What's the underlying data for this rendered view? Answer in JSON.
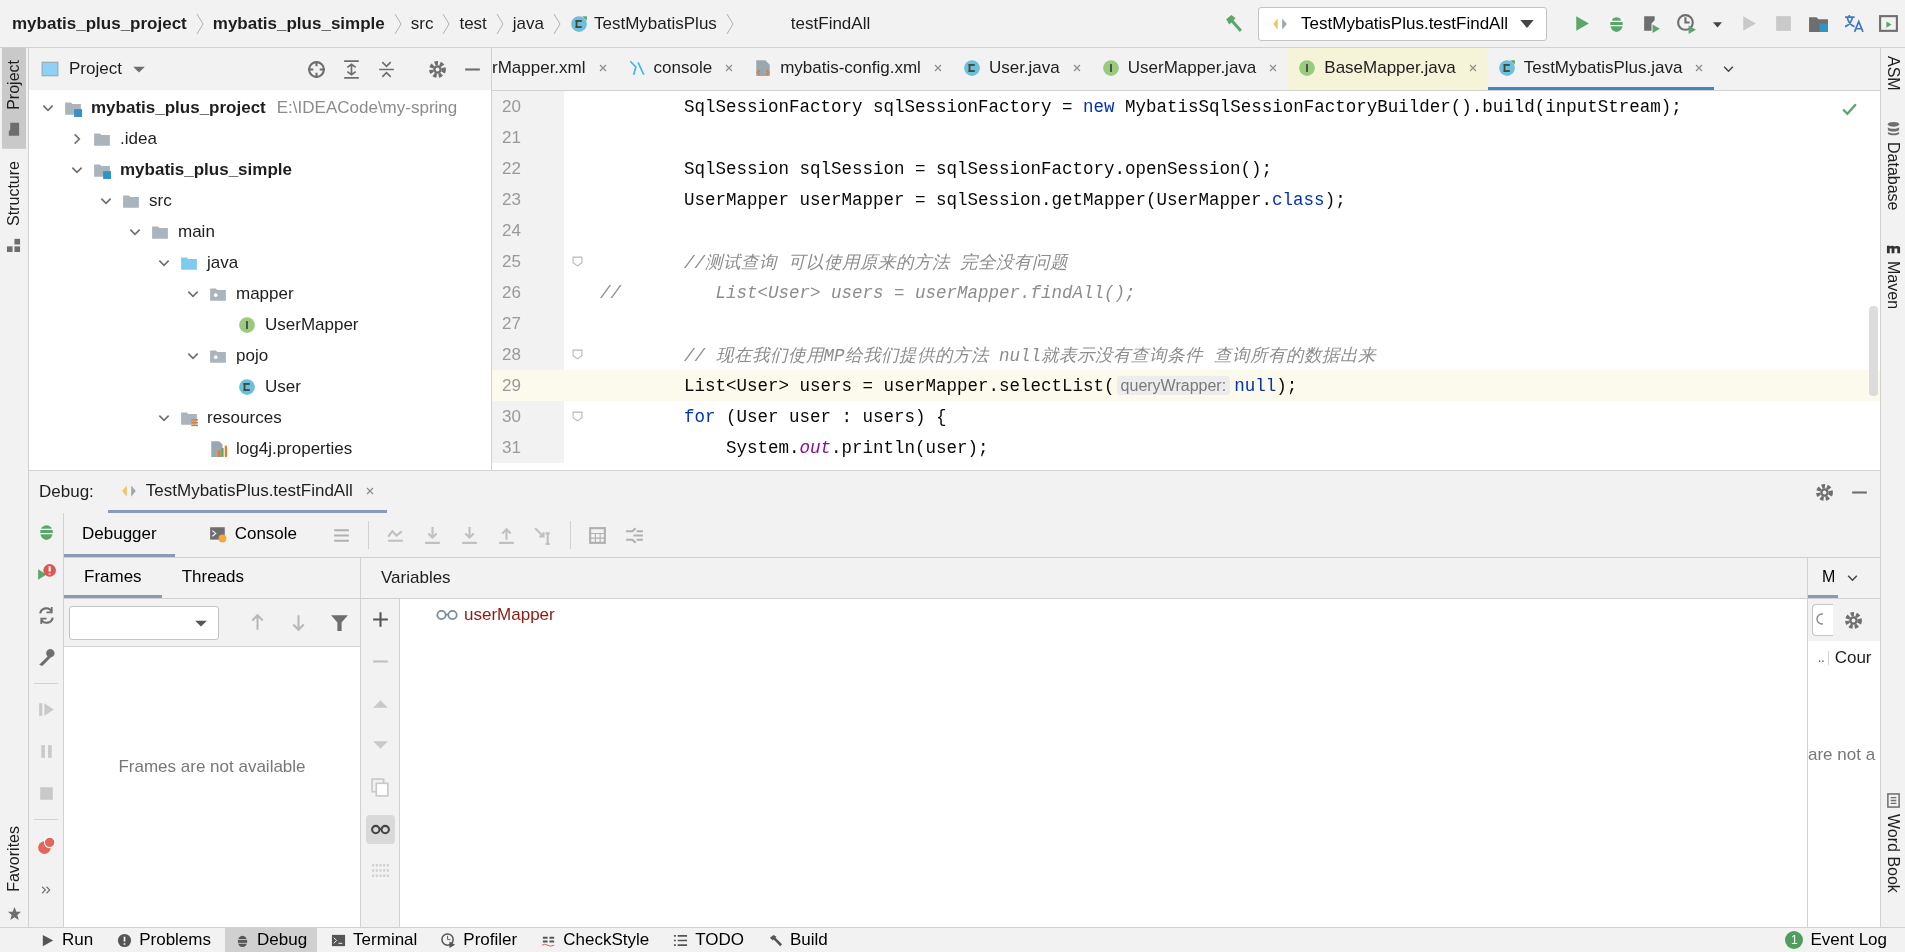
{
  "breadcrumbs": [
    {
      "label": "mybatis_plus_project",
      "bold": true
    },
    {
      "label": "mybatis_plus_simple",
      "bold": true
    },
    {
      "label": "src",
      "bold": false
    },
    {
      "label": "test",
      "bold": false
    },
    {
      "label": "java",
      "bold": false
    },
    {
      "label": "TestMybatisPlus",
      "bold": false,
      "kind": "test-class"
    }
  ],
  "method_crumb": "testFindAll",
  "run_config": "TestMybatisPlus.testFindAll",
  "left_strip": [
    {
      "label": "Project",
      "selected": true,
      "kind": "folder"
    },
    {
      "label": "Structure",
      "selected": false,
      "kind": "structure"
    }
  ],
  "left_strip_bottom": {
    "label": "Favorites"
  },
  "right_strip": [
    {
      "label": "ASM",
      "kind": "none"
    },
    {
      "label": "Database",
      "kind": "database"
    },
    {
      "label": "Maven",
      "kind": "maven"
    }
  ],
  "right_strip_bottom": {
    "label": "Word Book"
  },
  "project": {
    "title": "Project",
    "tree": [
      {
        "label": "mybatis_plus_project",
        "kind": "module",
        "location": "E:\\IDEACode\\my-spring",
        "expanded": true,
        "children": [
          {
            "label": ".idea",
            "kind": "folder",
            "expanded": false
          },
          {
            "label": "mybatis_plus_simple",
            "kind": "module",
            "expanded": true,
            "children": [
              {
                "label": "src",
                "kind": "folder",
                "expanded": true,
                "children": [
                  {
                    "label": "main",
                    "kind": "folder",
                    "expanded": true,
                    "children": [
                      {
                        "label": "java",
                        "kind": "source-root",
                        "expanded": true,
                        "children": [
                          {
                            "label": "mapper",
                            "kind": "package",
                            "expanded": true,
                            "children": [
                              {
                                "label": "UserMapper",
                                "kind": "interface"
                              }
                            ]
                          },
                          {
                            "label": "pojo",
                            "kind": "package",
                            "expanded": true,
                            "children": [
                              {
                                "label": "User",
                                "kind": "class"
                              }
                            ]
                          }
                        ]
                      },
                      {
                        "label": "resources",
                        "kind": "resources",
                        "expanded": true,
                        "children": [
                          {
                            "label": "log4j.properties",
                            "kind": "properties"
                          }
                        ]
                      }
                    ]
                  }
                ]
              }
            ]
          }
        ]
      }
    ]
  },
  "editor_tabs": [
    {
      "label": "rMapper.xml",
      "kind": "xml",
      "selected": false,
      "modified": false
    },
    {
      "label": "console",
      "kind": "console",
      "selected": false,
      "modified": false
    },
    {
      "label": "mybatis-config.xml",
      "kind": "config",
      "selected": false,
      "modified": false
    },
    {
      "label": "User.java",
      "kind": "class",
      "selected": false,
      "modified": false
    },
    {
      "label": "UserMapper.java",
      "kind": "interface",
      "selected": false,
      "modified": false
    },
    {
      "label": "BaseMapper.java",
      "kind": "interface",
      "selected": false,
      "modified": true
    },
    {
      "label": "TestMybatisPlus.java",
      "kind": "test-class",
      "selected": true,
      "modified": false
    }
  ],
  "code": [
    {
      "number": "20",
      "current": false,
      "fold": false,
      "tokens": [
        {
          "text": "        SqlSessionFactory sqlSessionFactory = ",
          "kind": "plain"
        },
        {
          "text": "new",
          "kind": "keyword"
        },
        {
          "text": " MybatisSqlSessionFactoryBuilder().build(inputStream);",
          "kind": "plain"
        }
      ]
    },
    {
      "number": "21",
      "current": false,
      "fold": false
    },
    {
      "number": "22",
      "current": false,
      "fold": false,
      "tokens": [
        {
          "text": "        SqlSession sqlSession = sqlSessionFactory.openSession();",
          "kind": "plain"
        }
      ]
    },
    {
      "number": "23",
      "current": false,
      "fold": false,
      "tokens": [
        {
          "text": "        UserMapper userMapper = sqlSession.getMapper(UserMapper.",
          "kind": "plain"
        },
        {
          "text": "class",
          "kind": "keyword"
        },
        {
          "text": ");",
          "kind": "plain"
        }
      ]
    },
    {
      "number": "24",
      "current": false,
      "fold": false
    },
    {
      "number": "25",
      "current": false,
      "fold": true,
      "tokens": [
        {
          "text": "        //测试查询 可以使用原来的方法 完全没有问题",
          "kind": "comment"
        }
      ]
    },
    {
      "number": "26",
      "current": false,
      "fold": false,
      "tokens": [
        {
          "text": "//",
          "kind": "comment"
        },
        {
          "text": "         List<User> users = userMapper.findAll();",
          "kind": "commented-code"
        }
      ]
    },
    {
      "number": "27",
      "current": false,
      "fold": false
    },
    {
      "number": "28",
      "current": false,
      "fold": true,
      "tokens": [
        {
          "text": "        // 现在我们使用MP给我们提供的方法 null就表示没有查询条件 查询所有的数据出来",
          "kind": "comment"
        }
      ]
    },
    {
      "number": "29",
      "current": true,
      "fold": false,
      "tokens": [
        {
          "text": "        List<User> users = userMapper.selectList(",
          "kind": "plain"
        },
        {
          "text": "queryWrapper:",
          "kind": "hint"
        },
        {
          "text": "null",
          "kind": "keyword"
        },
        {
          "text": ");",
          "kind": "plain"
        }
      ]
    },
    {
      "number": "30",
      "current": false,
      "fold": true,
      "tokens": [
        {
          "text": "        for",
          "kind": "keyword"
        },
        {
          "text": " (User user : users) {",
          "kind": "plain"
        }
      ]
    },
    {
      "number": "31",
      "current": false,
      "fold": false,
      "tokens": [
        {
          "text": "            System.",
          "kind": "plain"
        },
        {
          "text": "out",
          "kind": "static-field"
        },
        {
          "text": ".println(user);",
          "kind": "plain"
        }
      ]
    }
  ],
  "debug": {
    "label": "Debug:",
    "session": {
      "label": "TestMybatisPlus.testFindAll",
      "selected": true
    },
    "tabs": [
      {
        "label": "Debugger",
        "kind": "debugger",
        "selected": true
      },
      {
        "label": "Console",
        "kind": "console",
        "selected": false
      }
    ],
    "frame_tabs": [
      {
        "label": "Frames",
        "selected": true
      },
      {
        "label": "Threads",
        "selected": false
      }
    ],
    "frames_message": "Frames are not available",
    "variables_title": "Variables",
    "watches_inline": {
      "selected": true
    },
    "variables": [
      {
        "name": "userMapper"
      }
    ],
    "side_panel": {
      "tab": {
        "label": "M",
        "selected": true
      },
      "row_marker": "..",
      "row_label": "Cour",
      "message": "are not a"
    }
  },
  "bottom_tools": [
    {
      "label": "Run",
      "kind": "run",
      "selected": false
    },
    {
      "label": "Problems",
      "kind": "problems",
      "selected": false
    },
    {
      "label": "Debug",
      "kind": "debug",
      "selected": true
    },
    {
      "label": "Terminal",
      "kind": "terminal",
      "selected": false
    },
    {
      "label": "Profiler",
      "kind": "profiler",
      "selected": false
    },
    {
      "label": "CheckStyle",
      "kind": "checkstyle",
      "selected": false
    },
    {
      "label": "TODO",
      "kind": "todo",
      "selected": false
    },
    {
      "label": "Build",
      "kind": "build",
      "selected": false
    }
  ],
  "event_log": {
    "label": "Event Log",
    "count": "1"
  }
}
